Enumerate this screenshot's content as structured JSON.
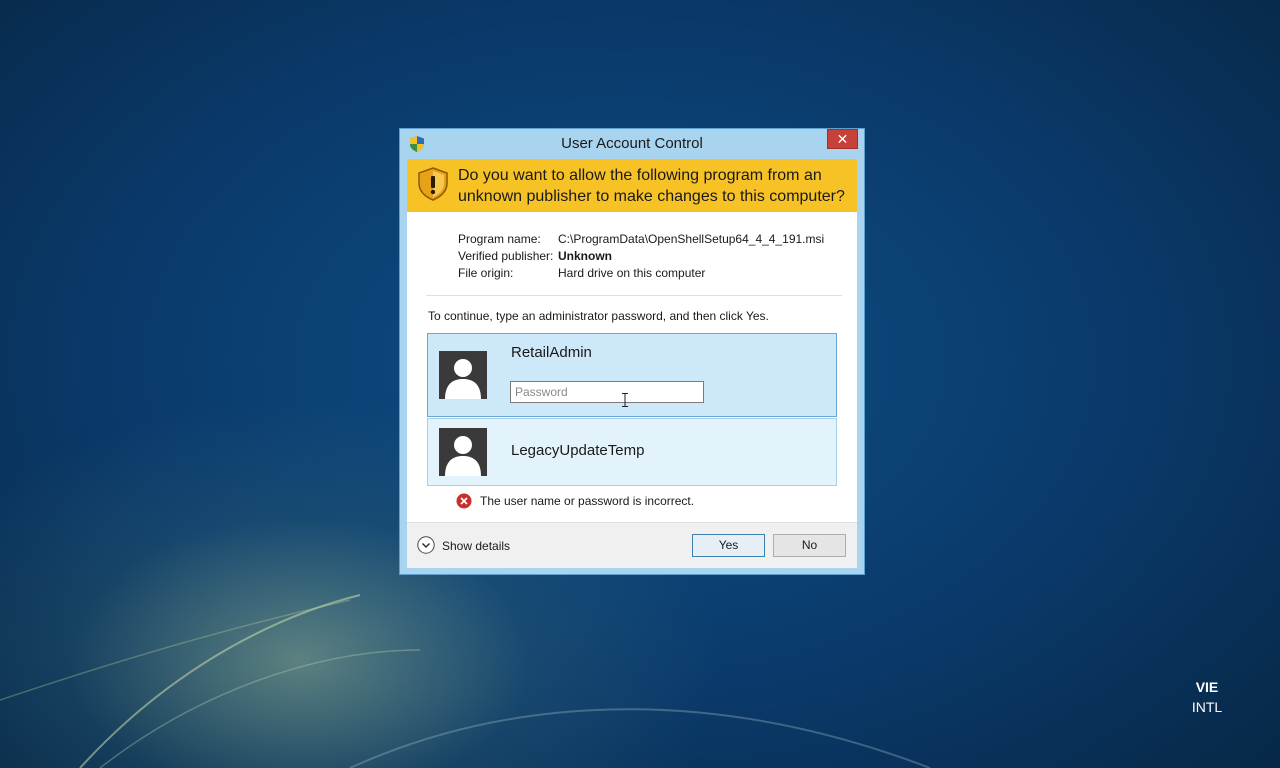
{
  "dialog": {
    "title": "User Account Control",
    "close_glyph": "✕",
    "question": "Do you want to allow the following program from an unknown publisher to make changes to this computer?",
    "details": {
      "program_name_label": "Program name:",
      "program_name_value": "C:\\ProgramData\\OpenShellSetup64_4_4_191.msi",
      "publisher_label": "Verified publisher:",
      "publisher_value": "Unknown",
      "origin_label": "File origin:",
      "origin_value": "Hard drive on this computer"
    },
    "instruction": "To continue, type an administrator password, and then click Yes.",
    "accounts": [
      {
        "name": "RetailAdmin",
        "selected": true,
        "password_placeholder": "Password",
        "password_value": ""
      },
      {
        "name": "LegacyUpdateTemp",
        "selected": false
      }
    ],
    "error": "The user name or password is incorrect.",
    "show_details_label": "Show details",
    "yes_label": "Yes",
    "no_label": "No"
  },
  "taskbar": {
    "language_code": "VIE",
    "layout_name": "INTL"
  },
  "colors": {
    "frame": "#a8d4ef",
    "banner": "#f7c226",
    "selected_tile": "#cde8f8",
    "close_button": "#c7403a",
    "desktop": "#0a3a6b"
  },
  "icons": [
    "uac-shield-icon",
    "warning-shield-icon",
    "user-avatar-icon",
    "error-icon",
    "chevron-down-icon",
    "close-icon",
    "text-cursor-icon"
  ]
}
